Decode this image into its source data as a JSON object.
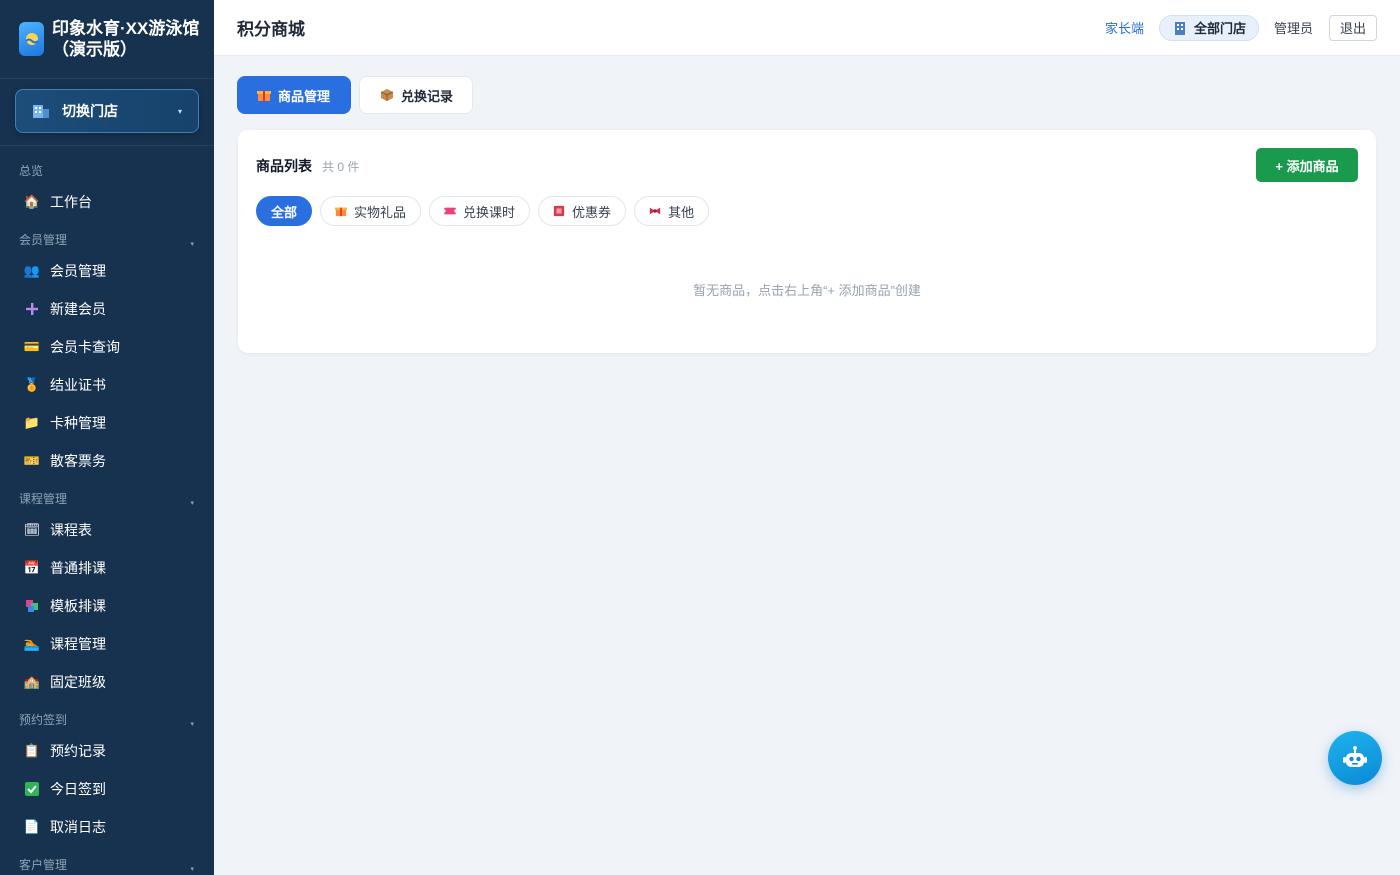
{
  "brand": {
    "title": "印象水育·XX游泳馆（演示版）"
  },
  "store_switch": {
    "label": "切换门店"
  },
  "sidebar": {
    "groups": [
      {
        "label": "总览",
        "items": [
          {
            "label": "工作台",
            "icon": "home-icon"
          }
        ]
      },
      {
        "label": "会员管理",
        "items": [
          {
            "label": "会员管理",
            "icon": "members-icon"
          },
          {
            "label": "新建会员",
            "icon": "plus-icon"
          },
          {
            "label": "会员卡查询",
            "icon": "card-icon"
          },
          {
            "label": "结业证书",
            "icon": "medal-icon"
          },
          {
            "label": "卡种管理",
            "icon": "folder-icon"
          },
          {
            "label": "散客票务",
            "icon": "ticket-icon"
          }
        ]
      },
      {
        "label": "课程管理",
        "items": [
          {
            "label": "课程表",
            "icon": "calendar-icon"
          },
          {
            "label": "普通排课",
            "icon": "calendar-grid-icon"
          },
          {
            "label": "模板排课",
            "icon": "template-icon"
          },
          {
            "label": "课程管理",
            "icon": "swim-icon"
          },
          {
            "label": "固定班级",
            "icon": "school-icon"
          }
        ]
      },
      {
        "label": "预约签到",
        "items": [
          {
            "label": "预约记录",
            "icon": "clipboard-icon"
          },
          {
            "label": "今日签到",
            "icon": "check-icon"
          },
          {
            "label": "取消日志",
            "icon": "document-icon"
          }
        ]
      },
      {
        "label": "客户管理",
        "items": []
      }
    ]
  },
  "header": {
    "title": "积分商城",
    "parent_link": "家长端",
    "store_chip": "全部门店",
    "role": "管理员",
    "logout": "退出"
  },
  "tabs": [
    {
      "label": "商品管理",
      "active": true,
      "icon": "gift-icon"
    },
    {
      "label": "兑换记录",
      "active": false,
      "icon": "package-icon"
    }
  ],
  "card": {
    "title": "商品列表",
    "count": "共 0 件",
    "add_button": "+ 添加商品",
    "empty_text": "暂无商品，点击右上角“+ 添加商品”创建"
  },
  "filters": [
    {
      "label": "全部",
      "active": true,
      "icon": ""
    },
    {
      "label": "实物礼品",
      "active": false,
      "icon": "gift-icon"
    },
    {
      "label": "兑换课时",
      "active": false,
      "icon": "ticket-icon"
    },
    {
      "label": "优惠券",
      "active": false,
      "icon": "coupon-icon"
    },
    {
      "label": "其他",
      "active": false,
      "icon": "bow-icon"
    }
  ],
  "colors": {
    "primary": "#2a6fe0",
    "success": "#1a9a4c",
    "sidebar": "#17324f"
  }
}
